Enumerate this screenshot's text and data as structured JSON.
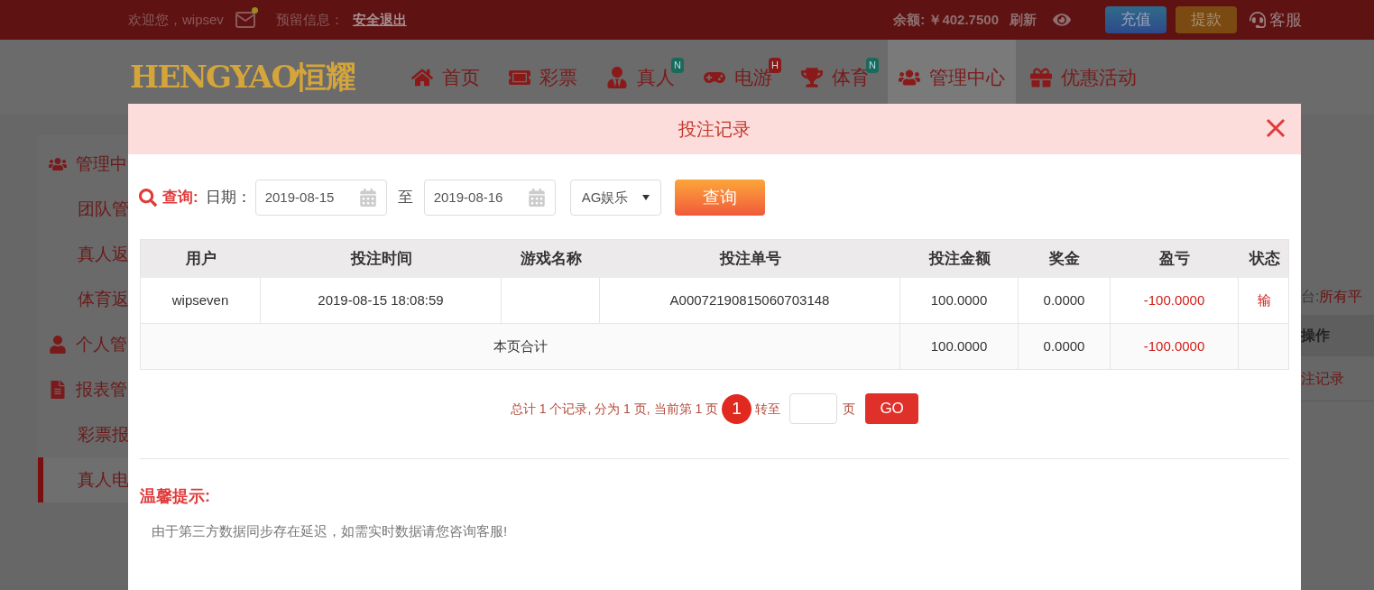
{
  "top_bar": {
    "welcome": "欢迎您，wipsev",
    "notice_label": "预留信息：",
    "logout": "安全退出",
    "balance": "余额: ￥402.7500",
    "refresh": "刷新",
    "deposit": "充值",
    "withdraw": "提款",
    "service": "客服"
  },
  "logo": "HENGYAO恒耀",
  "nav": [
    {
      "label": "首页",
      "selected": false
    },
    {
      "label": "彩票",
      "selected": false
    },
    {
      "label": "真人",
      "badge": "N",
      "selected": false
    },
    {
      "label": "电游",
      "badge": "H",
      "selected": false
    },
    {
      "label": "体育",
      "badge": "N",
      "selected": false
    },
    {
      "label": "管理中心",
      "selected": true
    },
    {
      "label": "优惠活动",
      "selected": false
    }
  ],
  "sidebar": [
    {
      "label": "管理中",
      "kind": "group",
      "selected": false
    },
    {
      "label": "团队管",
      "kind": "item",
      "selected": false
    },
    {
      "label": "真人返",
      "kind": "item",
      "selected": false
    },
    {
      "label": "体育返",
      "kind": "item",
      "selected": false
    },
    {
      "label": "个人管",
      "kind": "group",
      "selected": false
    },
    {
      "label": "报表管",
      "kind": "group",
      "selected": false
    },
    {
      "label": "彩票报",
      "kind": "item",
      "selected": false
    },
    {
      "label": "真人电",
      "kind": "item",
      "selected": true
    }
  ],
  "background_panel": {
    "filter_label": "台:",
    "filter_value": "所有平",
    "column": "操作",
    "link": "注记录"
  },
  "dialog": {
    "title": "投注记录",
    "query": {
      "label": "查询:",
      "date_label": "日期：",
      "from": "2019-08-15",
      "to_label": "至",
      "to": "2019-08-16",
      "platform": "AG娱乐",
      "button": "查询"
    },
    "table": {
      "columns": [
        "用户",
        "投注时间",
        "游戏名称",
        "投注单号",
        "投注金额",
        "奖金",
        "盈亏",
        "状态"
      ],
      "rows": [
        [
          "wipseven",
          "2019-08-15 18:08:59",
          "",
          "A00072190815060703148",
          "100.0000",
          "0.0000",
          "-100.0000",
          "输"
        ]
      ],
      "summary": {
        "label": "本页合计",
        "values": [
          "100.0000",
          "0.0000",
          "-100.0000"
        ]
      }
    },
    "pagination": {
      "summary": "总计 1 个记录, 分为 1 页, 当前第 1 页",
      "pages": [
        {
          "label": "1",
          "selected": true
        }
      ],
      "goto_label": "转至",
      "page_unit": "页",
      "go": "GO"
    },
    "tips": {
      "title": "温馨提示:",
      "text": "由于第三方数据同步存在延迟，如需实时数据请您咨询客服!"
    }
  }
}
